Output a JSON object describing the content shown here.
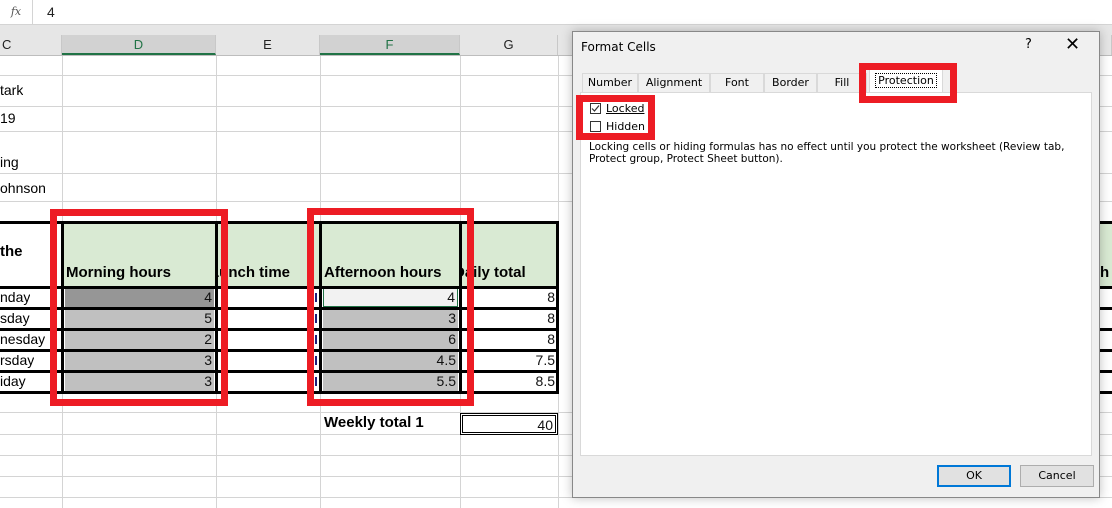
{
  "formula_bar": {
    "fx_label": "fx",
    "value": "4"
  },
  "columns": [
    "C",
    "D",
    "E",
    "F",
    "G"
  ],
  "left_fragments": [
    "tark",
    "19",
    "ing",
    "ohnson",
    "the"
  ],
  "table": {
    "headers": {
      "morning": "Morning hours",
      "lunch": "Lunch time",
      "afternoon": "Afternoon hours",
      "daily": "Daily total",
      "right_fragment": "h"
    },
    "rows": [
      {
        "day": "nday",
        "morning": "4",
        "afternoon": "4",
        "daily": "8"
      },
      {
        "day": "sday",
        "morning": "5",
        "afternoon": "3",
        "daily": "8"
      },
      {
        "day": "nesday",
        "morning": "2",
        "afternoon": "6",
        "daily": "8"
      },
      {
        "day": "rsday",
        "morning": "3",
        "afternoon": "4.5",
        "daily": "7.5"
      },
      {
        "day": "iday",
        "morning": "3",
        "afternoon": "5.5",
        "daily": "8.5"
      }
    ],
    "weekly_label": "Weekly total 1",
    "weekly_value": "40"
  },
  "dialog": {
    "title": "Format Cells",
    "help": "?",
    "close": "✕",
    "tabs": [
      "Number",
      "Alignment",
      "Font",
      "Border",
      "Fill",
      "Protection"
    ],
    "active_tab": "Protection",
    "locked_label": "Locked",
    "locked_checked": true,
    "hidden_label": "Hidden",
    "hidden_checked": false,
    "note": "Locking cells or hiding formulas has no effect until you protect the worksheet (Review tab, Protect group, Protect Sheet button).",
    "ok": "OK",
    "cancel": "Cancel"
  },
  "colors": {
    "header_fill": "#d9ead3",
    "highlight_red": "#ed1c24",
    "selection_green": "#217346",
    "ok_border": "#0078d7"
  }
}
